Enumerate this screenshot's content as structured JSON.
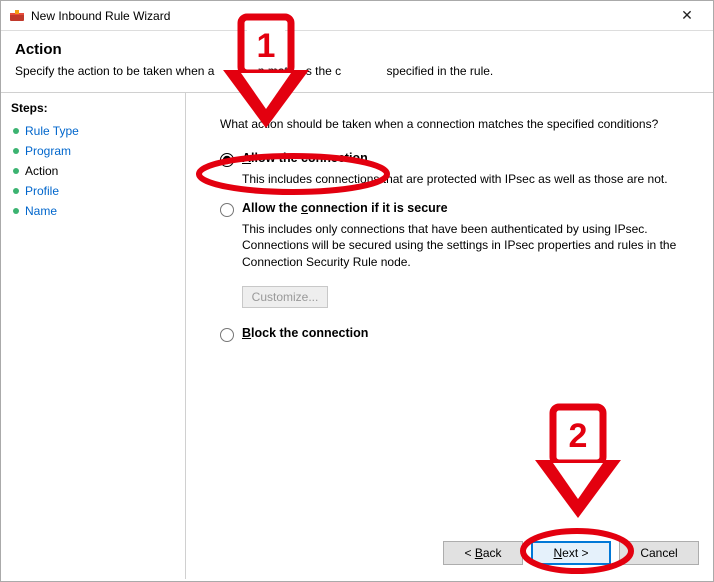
{
  "window": {
    "title": "New Inbound Rule Wizard",
    "close_glyph": "✕"
  },
  "header": {
    "title": "Action",
    "subtitle_pre": "Specify the action to be taken when a ",
    "subtitle_mid1": "n mat",
    "subtitle_mid2": "s the c",
    "subtitle_post": " specified in the rule."
  },
  "sidebar": {
    "label": "Steps:",
    "items": [
      {
        "label": "Rule Type"
      },
      {
        "label": "Program"
      },
      {
        "label": "Action"
      },
      {
        "label": "Profile"
      },
      {
        "label": "Name"
      }
    ],
    "current_index": 2
  },
  "content": {
    "prompt": "What action should be taken when a connection matches the specified conditions?",
    "options": [
      {
        "key_char": "A",
        "label_rest": "llow the connection",
        "desc": "This includes connections that are protected with IPsec as well as those are not.",
        "checked": true
      },
      {
        "key_char": "c",
        "label_pre": "Allow the ",
        "label_rest": "onnection if it is secure",
        "desc": "This includes only connections that have been authenticated by using IPsec.  Connections will be secured using the settings in IPsec properties and rules in the Connection Security Rule node.",
        "checked": false,
        "customize_label": "Customize..."
      },
      {
        "key_char": "B",
        "label_pre": "",
        "label_rest": "lock the connection",
        "desc": "",
        "checked": false
      }
    ]
  },
  "footer": {
    "back_char": "B",
    "back_rest": "ack",
    "back_prefix": "< ",
    "next_char": "N",
    "next_rest": "ext >",
    "cancel": "Cancel"
  },
  "annotations": {
    "arrow1_num": "1",
    "arrow2_num": "2"
  },
  "colors": {
    "annotation_red": "#e3000f",
    "link_blue": "#0066cc",
    "primary_blue": "#0078d7"
  }
}
